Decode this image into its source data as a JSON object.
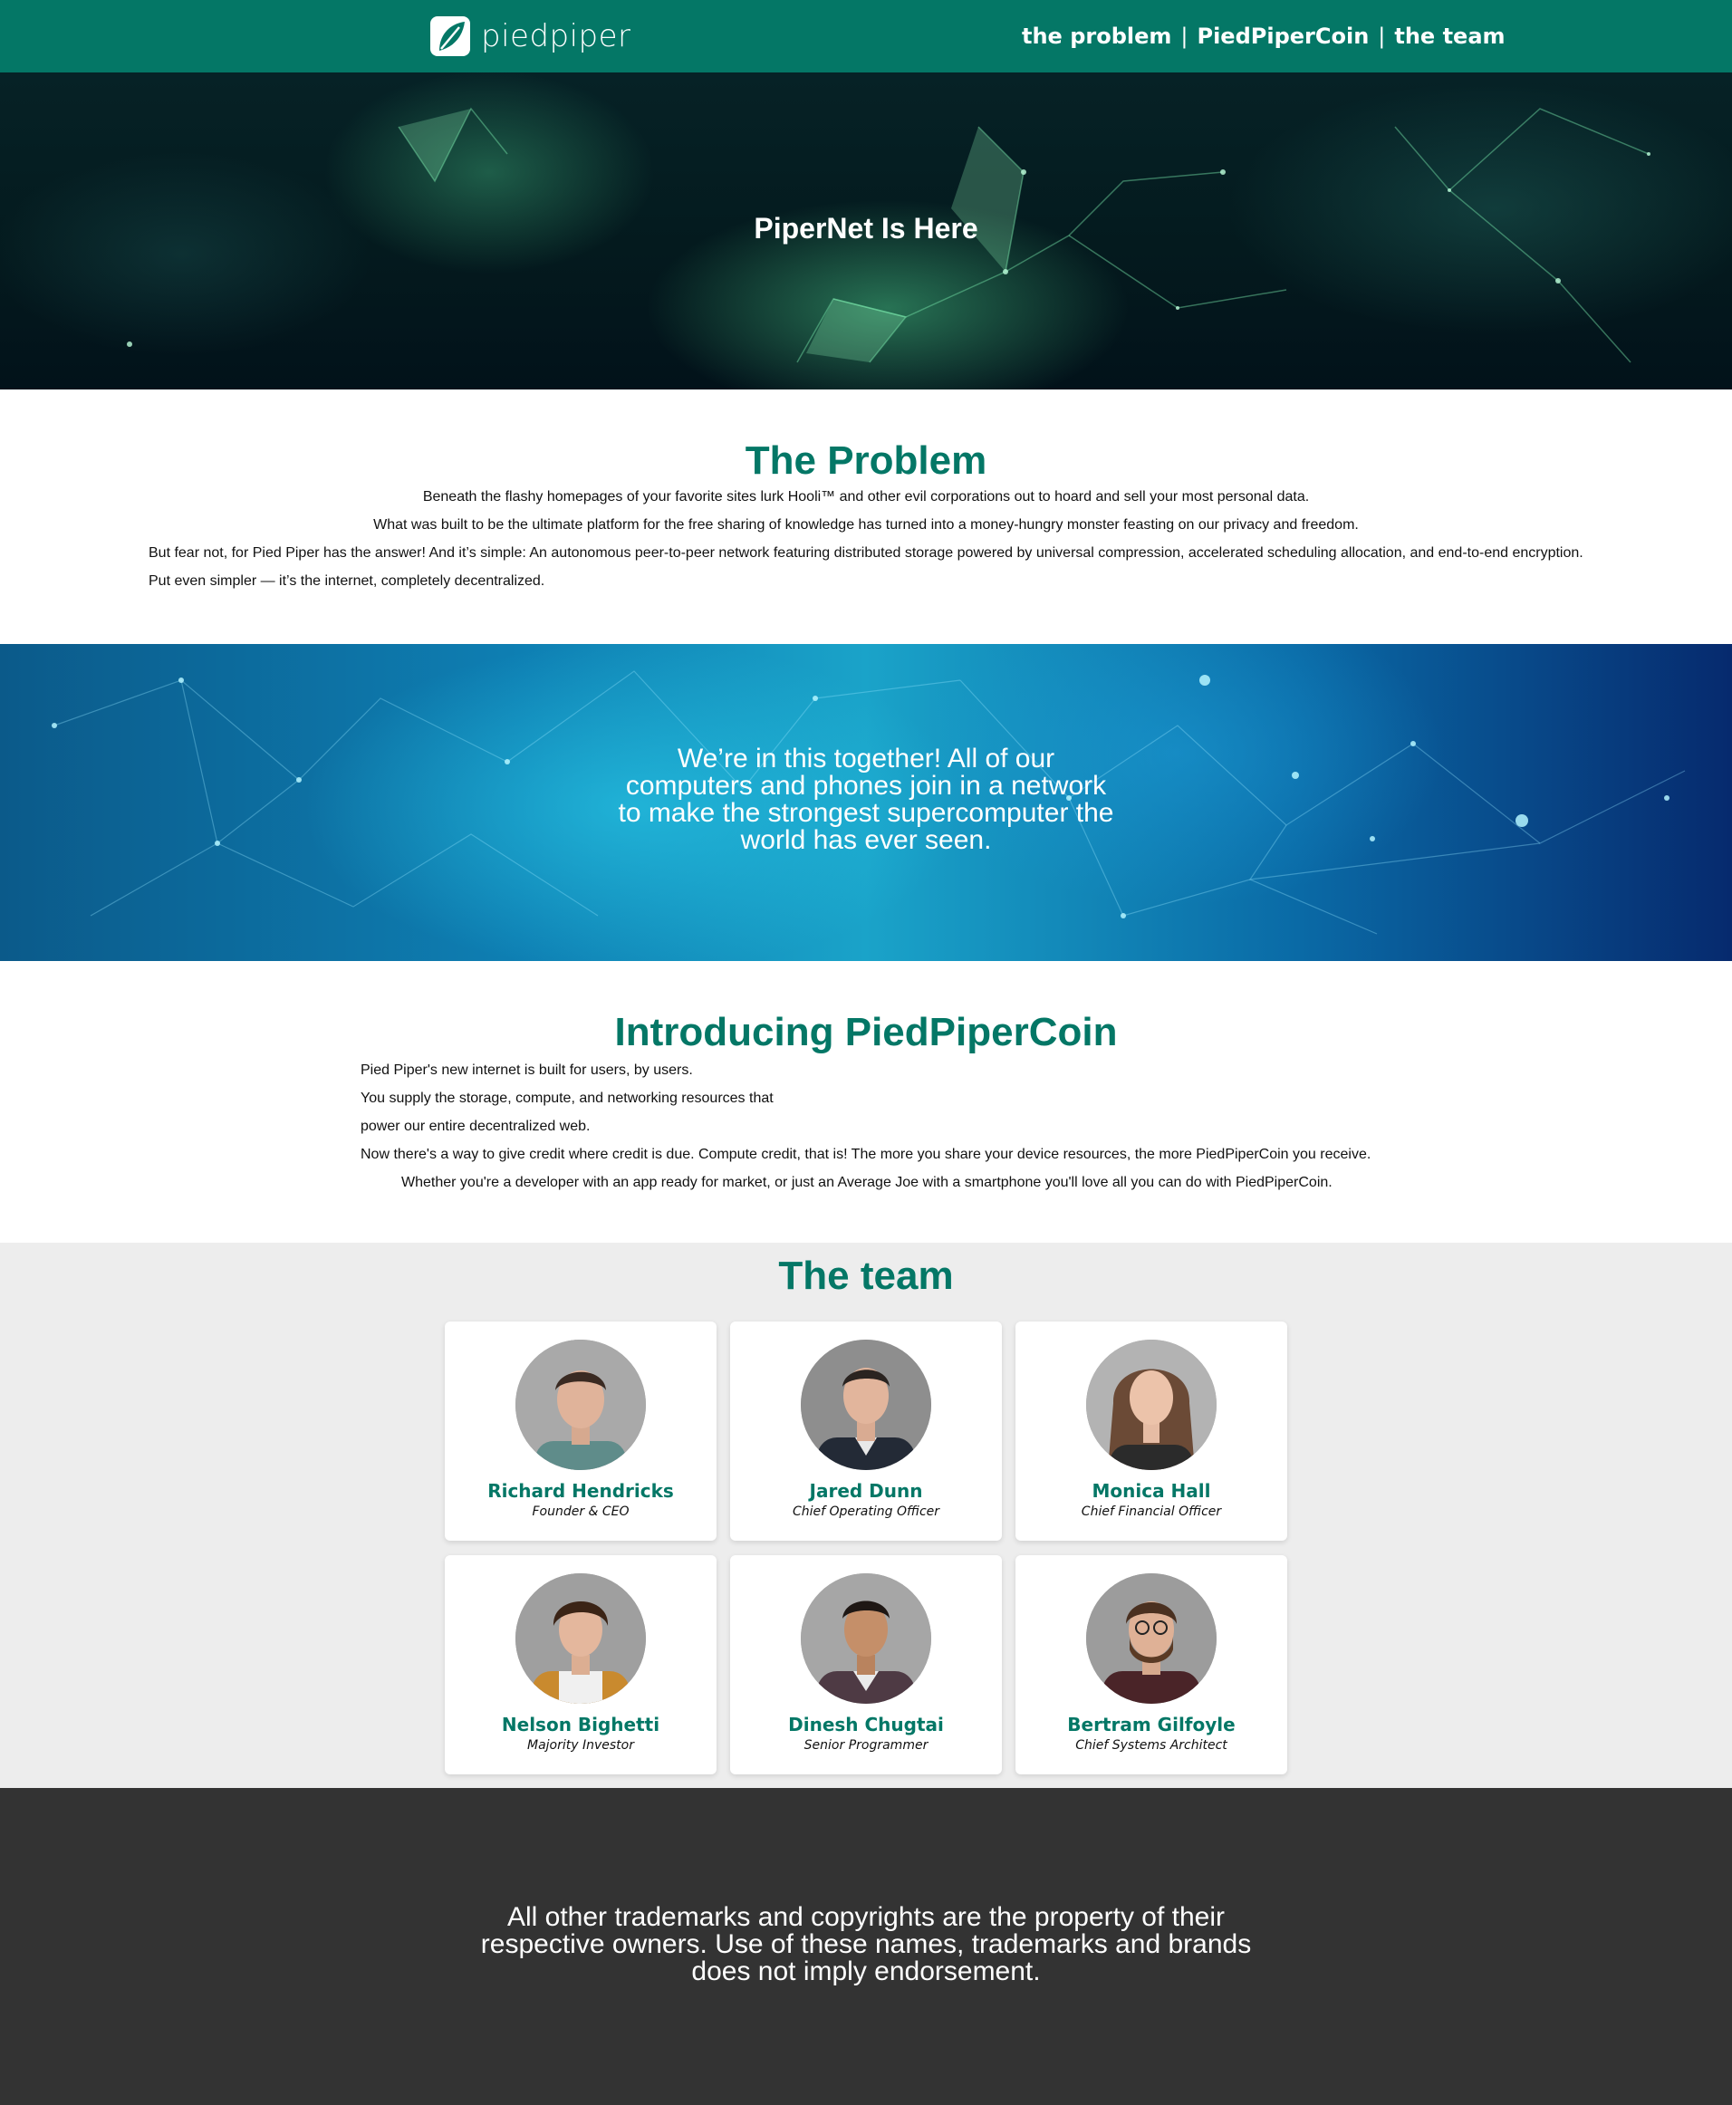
{
  "header": {
    "logo_text": "piedpiper",
    "nav": [
      {
        "label": "the problem"
      },
      {
        "label": "PiedPiperCoin"
      },
      {
        "label": "the team"
      }
    ],
    "separator": "|",
    "background_color": "#047766"
  },
  "hero1": {
    "title": "PiperNet Is Here"
  },
  "problem": {
    "title": "The Problem",
    "paragraphs": [
      "Beneath the flashy homepages of your favorite sites lurk Hooli™ and other evil corporations out to hoard and sell your most personal data.",
      "What was built to be the ultimate platform for the free sharing of knowledge has turned into a money-hungry monster feasting on our privacy and freedom.",
      "But fear not, for Pied Piper has the answer! And it’s simple: An autonomous peer-to-peer network featuring distributed storage powered by universal compression, accelerated scheduling allocation, and end-to-end encryption.",
      "Put even simpler — it’s the internet, completely decentralized."
    ]
  },
  "hero2": {
    "lines": [
      "We’re in this together! All of our",
      "computers and phones join in a network",
      "to make the strongest supercomputer the",
      "world has ever seen."
    ]
  },
  "coin": {
    "title": "Introducing PiedPiperCoin",
    "paragraphs": [
      "Pied Piper's new internet is built for users, by users.",
      "You supply the storage, compute, and networking resources that",
      "power our entire decentralized web.",
      "Now there's a way to give credit where credit is due. Compute credit, that is! The more you share your device resources, the more PiedPiperCoin you receive.",
      "Whether you're a developer with an app ready for market, or just an Average Joe with a smartphone you'll love all you can do with PiedPiperCoin."
    ]
  },
  "team": {
    "title": "The team",
    "members": [
      {
        "name": "Richard Hendricks",
        "role": "Founder & CEO"
      },
      {
        "name": "Jared Dunn",
        "role": "Chief Operating Officer"
      },
      {
        "name": "Monica Hall",
        "role": "Chief Financial Officer"
      },
      {
        "name": "Nelson Bighetti",
        "role": "Majority Investor"
      },
      {
        "name": "Dinesh Chugtai",
        "role": "Senior Programmer"
      },
      {
        "name": "Bertram Gilfoyle",
        "role": "Chief Systems Architect"
      }
    ]
  },
  "footer": {
    "lines": [
      "All other trademarks and copyrights are the property of their",
      "respective owners. Use of these names, trademarks and brands",
      "does not imply endorsement."
    ]
  }
}
